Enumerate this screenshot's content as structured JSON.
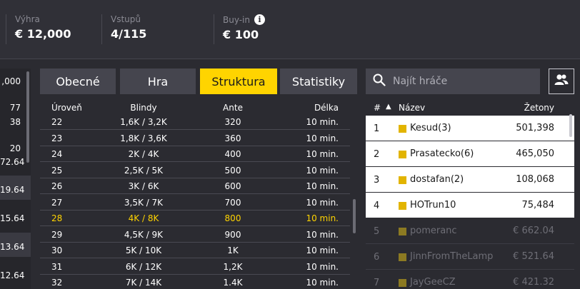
{
  "stats": [
    {
      "label": "Výhra",
      "value": "€ 12,000"
    },
    {
      "label": "Vstupů",
      "value": "4/115"
    },
    {
      "label": "Buy-in",
      "value": "€ 100",
      "info_icon": "i"
    }
  ],
  "left_column": {
    "values": [
      ",000",
      "77",
      "38",
      "20",
      "72.64",
      "19.64",
      "15.64",
      "13.64",
      "12.64"
    ]
  },
  "tabs": [
    {
      "label": "Obecné"
    },
    {
      "label": "Hra"
    },
    {
      "label": "Struktura",
      "active": true
    },
    {
      "label": "Statistiky"
    }
  ],
  "structure": {
    "headers": {
      "level": "Úroveň",
      "blinds": "Blindy",
      "ante": "Ante",
      "length": "Délka"
    },
    "rows": [
      {
        "level": "22",
        "blinds": "1,6K / 3,2K",
        "ante": "320",
        "length": "10 min."
      },
      {
        "level": "23",
        "blinds": "1,8K / 3,6K",
        "ante": "360",
        "length": "10 min."
      },
      {
        "level": "24",
        "blinds": "2K / 4K",
        "ante": "400",
        "length": "10 min."
      },
      {
        "level": "25",
        "blinds": "2,5K / 5K",
        "ante": "500",
        "length": "10 min."
      },
      {
        "level": "26",
        "blinds": "3K / 6K",
        "ante": "600",
        "length": "10 min."
      },
      {
        "level": "27",
        "blinds": "3,5K / 7K",
        "ante": "700",
        "length": "10 min."
      },
      {
        "level": "28",
        "blinds": "4K / 8K",
        "ante": "800",
        "length": "10 min.",
        "current": true
      },
      {
        "level": "29",
        "blinds": "4,5K / 9K",
        "ante": "900",
        "length": "10 min."
      },
      {
        "level": "30",
        "blinds": "5K / 10K",
        "ante": "1K",
        "length": "10 min."
      },
      {
        "level": "31",
        "blinds": "6K / 12K",
        "ante": "1,2K",
        "length": "10 min."
      },
      {
        "level": "32",
        "blinds": "7K / 14K",
        "ante": "1.4K",
        "length": "10 min."
      }
    ],
    "highlight_color": "#ffd400"
  },
  "search": {
    "placeholder": "Najít hráče",
    "icon": "search-icon"
  },
  "users_button": {
    "icon": "users-icon"
  },
  "players": {
    "headers": {
      "rank": "#",
      "sort": "▲",
      "name": "Název",
      "chips": "Žetony"
    },
    "rows": [
      {
        "rank": "1",
        "name": "Kesud(3)",
        "chips": "501,398",
        "active": true
      },
      {
        "rank": "2",
        "name": "Prasatecko(6)",
        "chips": "465,050",
        "active": true
      },
      {
        "rank": "3",
        "name": "dostafan(2)",
        "chips": "108,068",
        "active": true
      },
      {
        "rank": "4",
        "name": "HOTrun10",
        "chips": "75,484",
        "active": true
      },
      {
        "rank": "5",
        "name": "pomeranc",
        "chips": "€ 662.04",
        "active": false
      },
      {
        "rank": "6",
        "name": "JinnFromTheLamp",
        "chips": "€ 521.64",
        "active": false
      },
      {
        "rank": "7",
        "name": "JayGeeCZ",
        "chips": "€ 421.32",
        "active": false
      }
    ],
    "accent": "#e2b400"
  }
}
